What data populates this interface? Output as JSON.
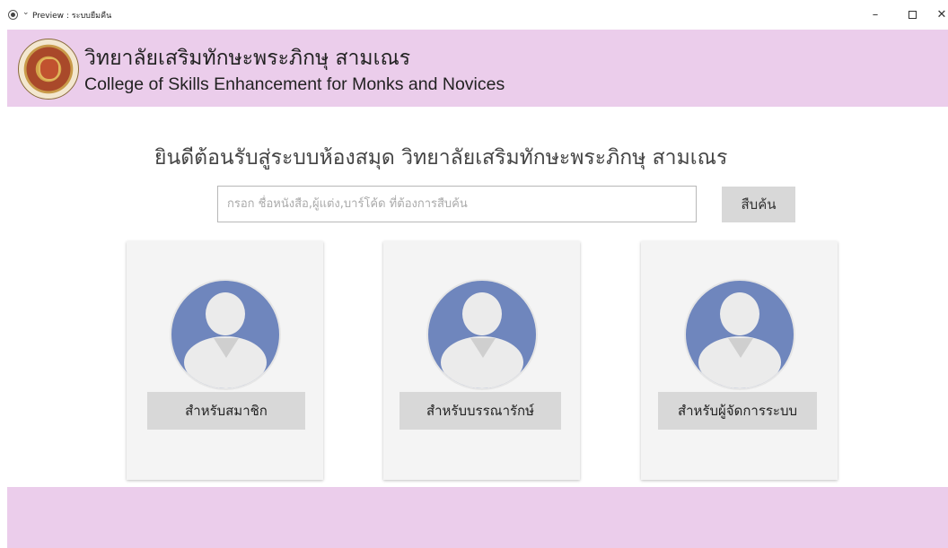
{
  "window": {
    "title": "Preview : ระบบยืมคืน",
    "minimize": "–",
    "close": "✕"
  },
  "header": {
    "title_th": "วิทยาลัยเสริมทักษะพระภิกษุ สามเณร",
    "title_en": "College of Skills Enhancement for Monks and Novices",
    "background": "#ebcdeb"
  },
  "welcome": {
    "text": "ยินดีต้อนรับสู่ระบบห้องสมุด วิทยาลัยเสริมทักษะพระภิกษุ สามเณร"
  },
  "search": {
    "value": "",
    "placeholder": "กรอก ชื่อหนังสือ,ผู้แต่ง,บาร์โค้ด ที่ต้องการสืบค้น",
    "button_label": "สืบค้น"
  },
  "roles": [
    {
      "label": "สำหรับสมาชิก",
      "icon": "user-avatar-icon"
    },
    {
      "label": "สำหรับบรรณารักษ์",
      "icon": "user-avatar-icon"
    },
    {
      "label": "สำหรับผู้จัดการระบบ",
      "icon": "user-avatar-icon"
    }
  ],
  "colors": {
    "accent": "#ebcdeb",
    "avatar": "#6f86bd",
    "button": "#d8d8d8",
    "card": "#f4f4f4"
  }
}
